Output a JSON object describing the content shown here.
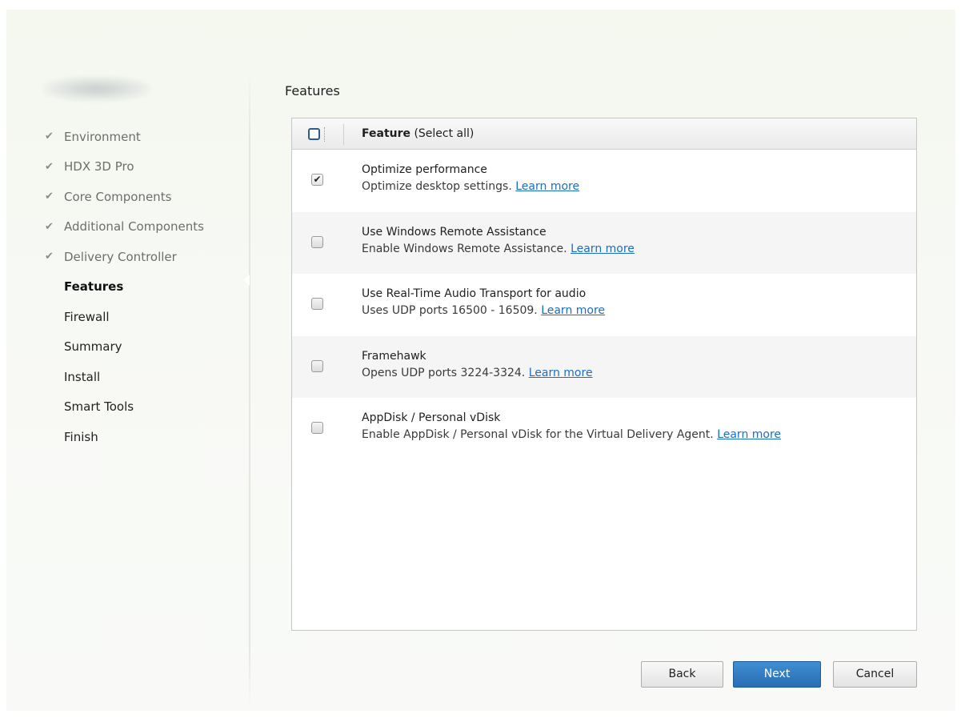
{
  "sidebar": {
    "steps": [
      {
        "label": "Environment",
        "status": "done"
      },
      {
        "label": "HDX 3D Pro",
        "status": "done"
      },
      {
        "label": "Core Components",
        "status": "done"
      },
      {
        "label": "Additional Components",
        "status": "done"
      },
      {
        "label": "Delivery Controller",
        "status": "done"
      },
      {
        "label": "Features",
        "status": "active"
      },
      {
        "label": "Firewall",
        "status": "pending"
      },
      {
        "label": "Summary",
        "status": "pending"
      },
      {
        "label": "Install",
        "status": "pending"
      },
      {
        "label": "Smart Tools",
        "status": "pending"
      },
      {
        "label": "Finish",
        "status": "pending"
      }
    ],
    "check_glyph": "✔"
  },
  "main": {
    "title": "Features",
    "table": {
      "header_label": "Feature",
      "header_select_all": "(Select all)",
      "select_all_checked": false,
      "rows": [
        {
          "title": "Optimize performance",
          "description": "Optimize desktop settings.",
          "link": "Learn more",
          "checked": true
        },
        {
          "title": "Use Windows Remote Assistance",
          "description": "Enable Windows Remote Assistance.",
          "link": "Learn more",
          "checked": false
        },
        {
          "title": "Use Real-Time Audio Transport for audio",
          "description": "Uses UDP ports 16500 - 16509.",
          "link": "Learn more",
          "checked": false
        },
        {
          "title": "Framehawk",
          "description": "Opens UDP ports 3224-3324.",
          "link": "Learn more",
          "checked": false
        },
        {
          "title": "AppDisk / Personal vDisk",
          "description": "Enable AppDisk / Personal vDisk for the Virtual Delivery Agent.",
          "link": "Learn more",
          "checked": false
        }
      ]
    }
  },
  "buttons": {
    "back": "Back",
    "next": "Next",
    "cancel": "Cancel"
  },
  "colors": {
    "accent": "#2a6db4",
    "link": "#1a6fc4",
    "background": "#f6f9f2"
  }
}
